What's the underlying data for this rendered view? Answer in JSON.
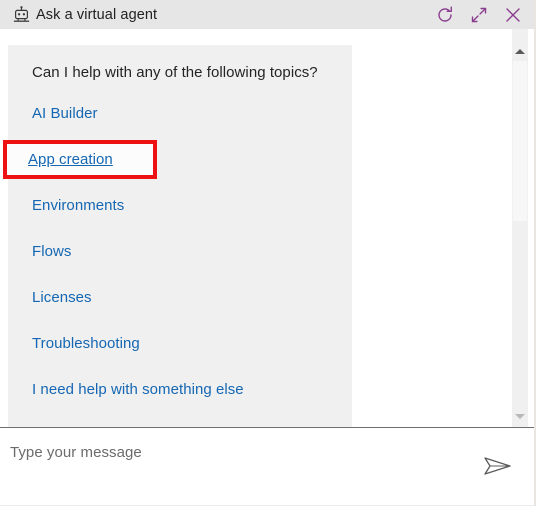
{
  "window": {
    "title": "Ask a virtual agent",
    "bot_icon": "robot-icon",
    "actions": [
      {
        "name": "refresh-icon",
        "label": "Refresh"
      },
      {
        "name": "minimize-icon",
        "label": "Minimize"
      },
      {
        "name": "close-icon",
        "label": "Close"
      }
    ],
    "accent_color": "#8a3d8f"
  },
  "chat": {
    "bubble_background": "#f0f0f0",
    "prompt": "Can I help with any of the following topics?",
    "link_color": "#1567b3",
    "suggestions": [
      {
        "label": "AI Builder",
        "active": false
      },
      {
        "label": "App creation",
        "active": true
      },
      {
        "label": "Environments",
        "active": false
      },
      {
        "label": "Flows",
        "active": false
      },
      {
        "label": "Licenses",
        "active": false
      },
      {
        "label": "Troubleshooting",
        "active": false
      },
      {
        "label": "I need help with something else",
        "active": false
      }
    ]
  },
  "annotation": {
    "target": "App creation",
    "color": "#ee1111"
  },
  "scrollbar": {
    "up_arrow": "scroll-up-arrow-icon",
    "down_arrow": "scroll-down-arrow-icon"
  },
  "composer": {
    "placeholder": "Type your message",
    "value": "",
    "send_icon": "send-paper-plane-icon"
  }
}
